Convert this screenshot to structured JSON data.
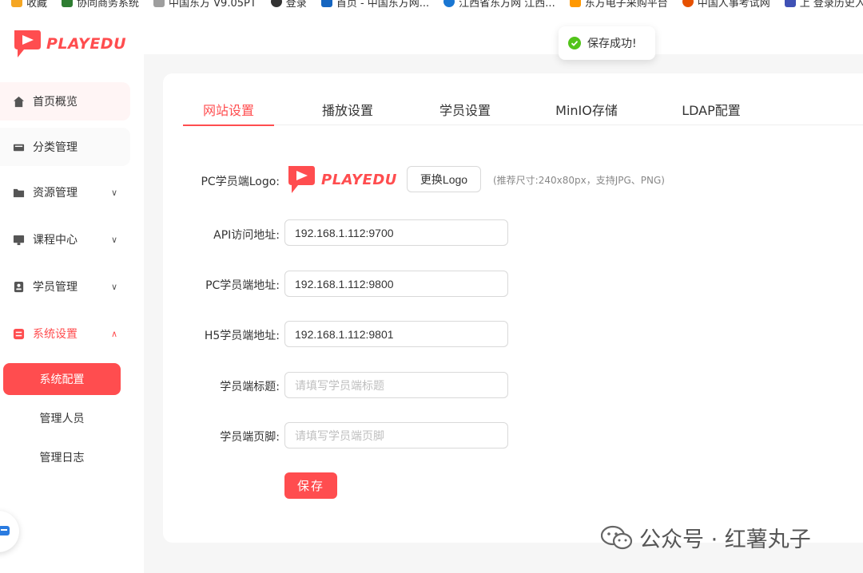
{
  "bookmarks": [
    {
      "label": "收藏",
      "color": "#f5a623"
    },
    {
      "label": "协同商务系统",
      "color": "#2e7d32"
    },
    {
      "label": "中国东方 V9.05PT",
      "color": "#555555"
    },
    {
      "label": "登录",
      "color": "#333333"
    },
    {
      "label": "首页 - 中国东方网...",
      "color": "#1565c0"
    },
    {
      "label": "江西省东方网 江西...",
      "color": "#1976d2"
    },
    {
      "label": "东方电子采购平台",
      "color": "#ff9800"
    },
    {
      "label": "中国人事考试网",
      "color": "#e65100"
    },
    {
      "label": "上 登录历史入 切换...",
      "color": "#3f51b5"
    }
  ],
  "brand": {
    "name": "PLAYEDU",
    "accent": "#ff4d4f"
  },
  "sidebar": {
    "items": [
      {
        "label": "首页概览",
        "icon": "home-icon",
        "chevron": ""
      },
      {
        "label": "分类管理",
        "icon": "category-icon",
        "chevron": ""
      },
      {
        "label": "资源管理",
        "icon": "folder-icon",
        "chevron": "∨"
      },
      {
        "label": "课程中心",
        "icon": "course-icon",
        "chevron": "∨"
      },
      {
        "label": "学员管理",
        "icon": "user-icon",
        "chevron": "∨"
      },
      {
        "label": "系统设置",
        "icon": "settings-icon",
        "chevron": "∧"
      }
    ],
    "sub_items": [
      {
        "label": "系统配置",
        "active": true
      },
      {
        "label": "管理人员",
        "active": false
      },
      {
        "label": "管理日志",
        "active": false
      }
    ]
  },
  "tabs": [
    {
      "label": "网站设置",
      "active": true
    },
    {
      "label": "播放设置",
      "active": false
    },
    {
      "label": "学员设置",
      "active": false
    },
    {
      "label": "MinIO存储",
      "active": false
    },
    {
      "label": "LDAP配置",
      "active": false
    }
  ],
  "form": {
    "logo_label": "PC学员端Logo:",
    "change_logo_button": "更换Logo",
    "logo_hint": "(推荐尺寸:240x80px，支持JPG、PNG)",
    "fields": [
      {
        "label": "API访问地址:",
        "value": "192.168.1.112:9700",
        "placeholder": ""
      },
      {
        "label": "PC学员端地址:",
        "value": "192.168.1.112:9800",
        "placeholder": ""
      },
      {
        "label": "H5学员端地址:",
        "value": "192.168.1.112:9801",
        "placeholder": ""
      },
      {
        "label": "学员端标题:",
        "value": "",
        "placeholder": "请填写学员端标题"
      },
      {
        "label": "学员端页脚:",
        "value": "",
        "placeholder": "请填写学员端页脚"
      }
    ],
    "save_button": "保存"
  },
  "toast": {
    "message": "保存成功!",
    "status_color": "#52c41a"
  },
  "watermark": {
    "text": "公众号 · 红薯丸子"
  }
}
